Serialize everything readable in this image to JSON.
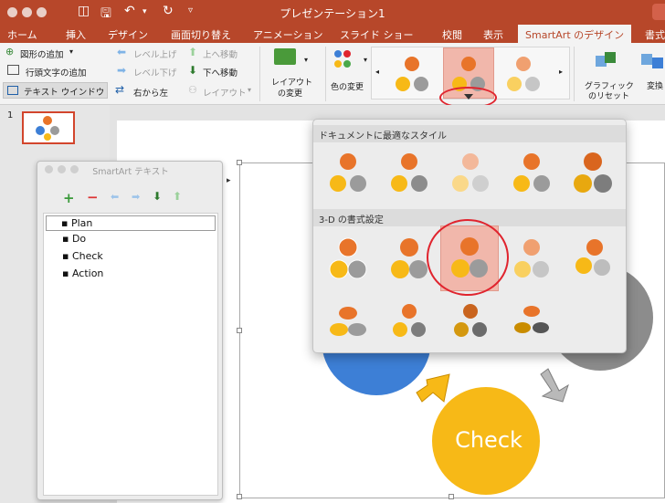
{
  "window": {
    "title": "プレゼンテーション1"
  },
  "tabs": [
    "ホーム",
    "挿入",
    "デザイン",
    "画面切り替え",
    "アニメーション",
    "スライド ショー",
    "校閲",
    "表示",
    "SmartArt のデザイン",
    "書式"
  ],
  "active_tab": "SmartArt のデザイン",
  "ribbon": {
    "add_shape": "図形の追加",
    "add_bullet": "行頭文字の追加",
    "text_pane": "テキスト ウインドウ",
    "promote": "レベル上げ",
    "demote": "レベル下げ",
    "rtl": "右から左",
    "move_up": "上へ移動",
    "move_down": "下へ移動",
    "layout": "レイアウト",
    "change_layout_1": "レイアウト",
    "change_layout_2": "の変更",
    "change_colors": "色の変更",
    "reset_graphic_1": "グラフィック",
    "reset_graphic_2": "のリセット",
    "convert": "変換"
  },
  "slides": {
    "number": "1"
  },
  "text_window": {
    "title": "SmartArt テキスト",
    "items": [
      "Plan",
      "Do",
      "Check",
      "Action"
    ]
  },
  "gallery": {
    "section_doc": "ドキュメントに最適なスタイル",
    "section_3d": "3-D の書式設定"
  },
  "slide": {
    "check_label": "Check"
  },
  "colors": {
    "accent": "#b7472a",
    "orange": "#e8742a",
    "yellow": "#f7b917",
    "gray": "#9b9b9b",
    "blue": "#3d7fd6",
    "highlight_ring": "#e0242e"
  }
}
